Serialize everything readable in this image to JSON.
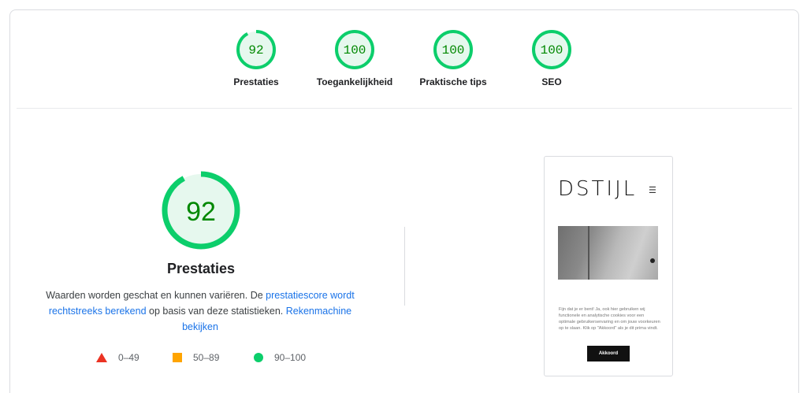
{
  "categories": [
    {
      "label": "Prestaties",
      "score": 92
    },
    {
      "label": "Toegankelijkheid",
      "score": 100
    },
    {
      "label": "Praktische tips",
      "score": 100
    },
    {
      "label": "SEO",
      "score": 100
    }
  ],
  "main": {
    "score": 92,
    "title": "Prestaties",
    "desc_text_1": "Waarden worden geschat en kunnen variëren. De ",
    "desc_link_1": "prestatiescore wordt rechtstreeks berekend",
    "desc_text_2": " op basis van deze statistieken. ",
    "desc_link_2": "Rekenmachine bekijken"
  },
  "legend": [
    {
      "icon": "triangle-icon",
      "range": "0–49",
      "color": "#eb3323"
    },
    {
      "icon": "square-icon",
      "range": "50–89",
      "color": "#ffa400"
    },
    {
      "icon": "circle-icon",
      "range": "90–100",
      "color": "#0cce6b"
    }
  ],
  "colors": {
    "pass": "#0cce6b",
    "pass_fill": "#e6f8ee",
    "pass_text": "#008800"
  },
  "preview": {
    "logo": "DSTIJL",
    "menu_icon": "hamburger-icon",
    "cookie_text": "Fijn dat je er bent! Ja, ook hier gebruiken wij functionele en analytische cookies voor een optimale gebruikerservaring en om jouw voorkeuren op te slaan. Klik op \"Akkoord\" als je dit prima vindt.",
    "button": "Akkoord"
  }
}
